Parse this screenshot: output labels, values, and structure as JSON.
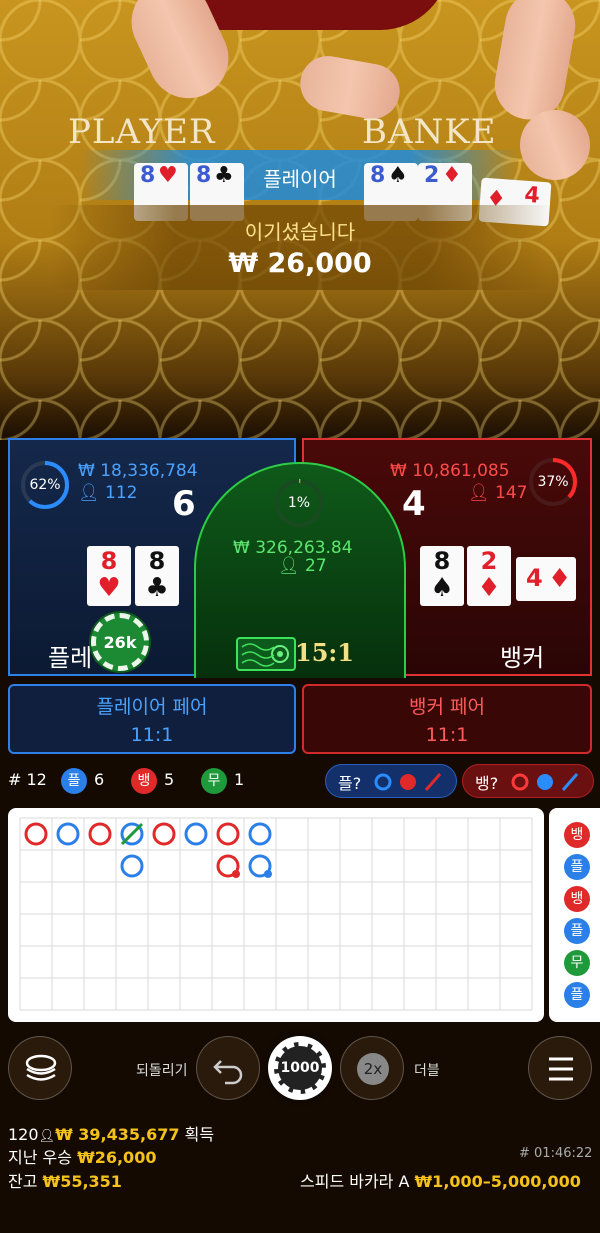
{
  "video": {
    "table_word_player": "PLAYER",
    "table_word_banker": "BANKE",
    "cards_player": [
      {
        "rank": "8",
        "suit": "♥",
        "color": "red"
      },
      {
        "rank": "8",
        "suit": "♣",
        "color": "black"
      }
    ],
    "cards_banker": [
      {
        "rank": "8",
        "suit": "♠",
        "color": "black"
      },
      {
        "rank": "2",
        "suit": "♦",
        "color": "red"
      },
      {
        "rank": "4",
        "suit": "♦",
        "color": "red"
      }
    ],
    "banner_label": "플레이어",
    "win_message": "이기셨습니다",
    "win_amount": "₩ 26,000"
  },
  "panels": {
    "player": {
      "percent": "62%",
      "percent_value": 0.62,
      "amount": "₩ 18,336,784",
      "players": "112",
      "score": "6",
      "label": "플레이어",
      "cards": [
        {
          "rank": "8",
          "suit": "♥",
          "color": "red"
        },
        {
          "rank": "8",
          "suit": "♣",
          "color": "black"
        }
      ],
      "chip": "26k"
    },
    "tie": {
      "percent": "1%",
      "percent_value": 0.01,
      "amount": "₩ 326,263.84",
      "players": "27",
      "payout": "15:1"
    },
    "banker": {
      "percent": "37%",
      "percent_value": 0.37,
      "amount": "₩ 10,861,085",
      "players": "147",
      "score": "4",
      "label": "뱅커",
      "cards": [
        {
          "rank": "8",
          "suit": "♠",
          "color": "black"
        },
        {
          "rank": "2",
          "suit": "♦",
          "color": "red"
        },
        {
          "rank": "4",
          "suit": "♦",
          "color": "red"
        }
      ]
    }
  },
  "pairs": {
    "player": {
      "label": "플레이어 페어",
      "payout": "11:1"
    },
    "banker": {
      "label": "뱅커 페어",
      "payout": "11:1"
    }
  },
  "stats": {
    "round": "# 12",
    "player_badge": "플",
    "player_count": "6",
    "banker_badge": "뱅",
    "banker_count": "5",
    "tie_badge": "무",
    "tie_count": "1",
    "predict_player": "플?",
    "predict_banker": "뱅?"
  },
  "colors": {
    "player": "#2a7fe8",
    "banker": "#e02a2a",
    "tie": "#1f9a3a",
    "gold": "#f4c21a"
  },
  "road": {
    "cells": [
      {
        "col": 0,
        "row": 0,
        "outcome": "B"
      },
      {
        "col": 1,
        "row": 0,
        "outcome": "P"
      },
      {
        "col": 2,
        "row": 0,
        "outcome": "B"
      },
      {
        "col": 3,
        "row": 0,
        "outcome": "P",
        "tie": true
      },
      {
        "col": 3,
        "row": 1,
        "outcome": "P"
      },
      {
        "col": 4,
        "row": 0,
        "outcome": "B"
      },
      {
        "col": 5,
        "row": 0,
        "outcome": "P"
      },
      {
        "col": 6,
        "row": 0,
        "outcome": "B"
      },
      {
        "col": 6,
        "row": 1,
        "outcome": "B",
        "pair": "player"
      },
      {
        "col": 7,
        "row": 0,
        "outcome": "P"
      },
      {
        "col": 7,
        "row": 1,
        "outcome": "P",
        "pair": "player"
      }
    ],
    "side": [
      {
        "label": "뱅",
        "type": "banker"
      },
      {
        "label": "플",
        "type": "player"
      },
      {
        "label": "뱅",
        "type": "banker"
      },
      {
        "label": "플",
        "type": "player"
      },
      {
        "label": "무",
        "type": "tie"
      },
      {
        "label": "플",
        "type": "player"
      }
    ]
  },
  "controls": {
    "undo_label": "되돌리기",
    "chip_value": "1000",
    "double_icon": "2x",
    "double_label": "더블"
  },
  "footer": {
    "players": "120",
    "total_win": "₩ 39,435,677",
    "total_win_suffix": "획득",
    "last_win_label": "지난 우승",
    "last_win": "₩26,000",
    "balance_label": "잔고",
    "balance": "₩55,351",
    "round_id": "# 01:46:22",
    "table_name": "스피드 바카라 A",
    "limits": "₩1,000–5,000,000"
  }
}
